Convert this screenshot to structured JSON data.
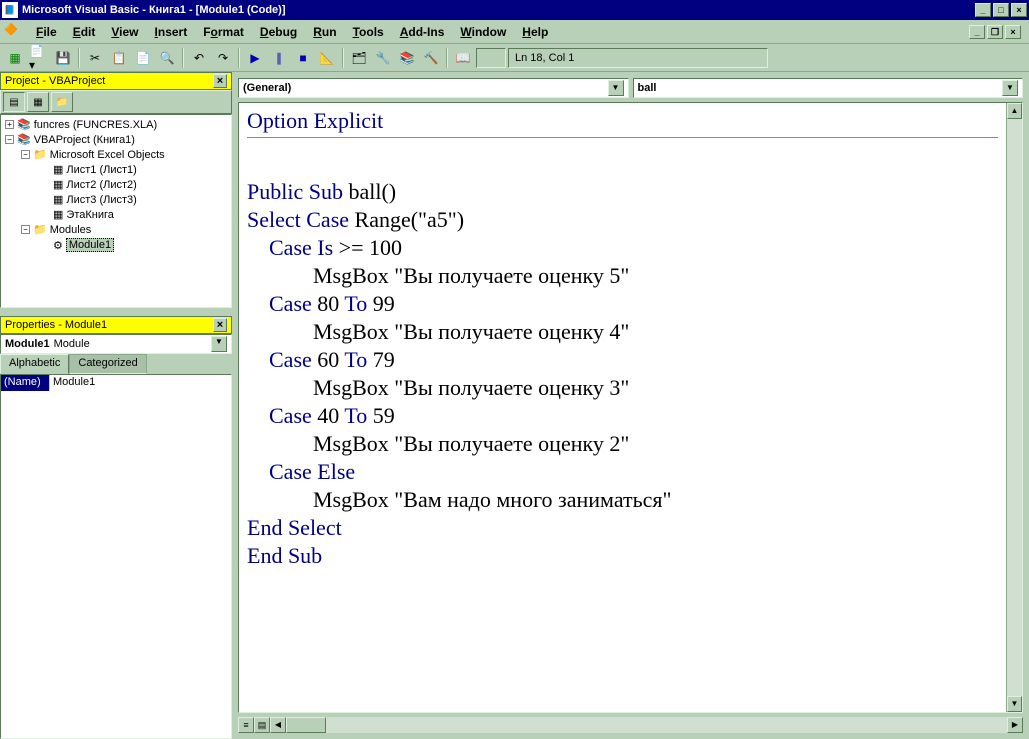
{
  "title": "Microsoft Visual Basic - Книга1 - [Module1 (Code)]",
  "menu": {
    "file": "File",
    "edit": "Edit",
    "view": "View",
    "insert": "Insert",
    "format": "Format",
    "debug": "Debug",
    "run": "Run",
    "tools": "Tools",
    "addins": "Add-Ins",
    "window": "Window",
    "help": "Help"
  },
  "toolbar": {
    "position": "Ln 18, Col 1"
  },
  "project": {
    "title": "Project - VBAProject",
    "items": [
      {
        "level": 1,
        "exp": "+",
        "icon": "📚",
        "label": "funcres (FUNCRES.XLA)"
      },
      {
        "level": 1,
        "exp": "−",
        "icon": "📚",
        "label": "VBAProject (Книга1)"
      },
      {
        "level": 2,
        "exp": "−",
        "icon": "📁",
        "label": "Microsoft Excel Objects"
      },
      {
        "level": 3,
        "exp": "",
        "icon": "▦",
        "label": "Лист1 (Лист1)"
      },
      {
        "level": 3,
        "exp": "",
        "icon": "▦",
        "label": "Лист2 (Лист2)"
      },
      {
        "level": 3,
        "exp": "",
        "icon": "▦",
        "label": "Лист3 (Лист3)"
      },
      {
        "level": 3,
        "exp": "",
        "icon": "▦",
        "label": "ЭтаКнига"
      },
      {
        "level": 2,
        "exp": "−",
        "icon": "📁",
        "label": "Modules"
      },
      {
        "level": 3,
        "exp": "",
        "icon": "⚙",
        "label": "Module1",
        "selected": true
      }
    ]
  },
  "properties": {
    "title": "Properties - Module1",
    "object_name": "Module1",
    "object_type": "Module",
    "tabs": {
      "a": "Alphabetic",
      "c": "Categorized"
    },
    "rows": [
      {
        "name": "(Name)",
        "value": "Module1"
      }
    ]
  },
  "code": {
    "object_combo": "(General)",
    "proc_combo": "ball",
    "lines": [
      {
        "t": "opt",
        "kw": "Option Explicit"
      },
      {
        "t": "div"
      },
      {
        "t": "blank"
      },
      {
        "t": "sub",
        "kw": "Public Sub ",
        "txt": "ball()"
      },
      {
        "t": "sel",
        "kw": "Select Case ",
        "txt": "Range(\"a5\")"
      },
      {
        "t": "ci",
        "indent": 1,
        "kw": "Case Is ",
        "txt": ">= 100"
      },
      {
        "t": "msg",
        "indent": 2,
        "txt": "MsgBox \"Вы получаете оценку 5\""
      },
      {
        "t": "c",
        "indent": 1,
        "kw": "Case ",
        "txt1": "80 ",
        "kw2": "To ",
        "txt2": "99"
      },
      {
        "t": "msg",
        "indent": 2,
        "txt": "MsgBox \"Вы получаете оценку 4\""
      },
      {
        "t": "c",
        "indent": 1,
        "kw": "Case ",
        "txt1": "60 ",
        "kw2": "To ",
        "txt2": "79"
      },
      {
        "t": "msg",
        "indent": 2,
        "txt": "MsgBox \"Вы получаете оценку 3\""
      },
      {
        "t": "c",
        "indent": 1,
        "kw": "Case ",
        "txt1": "40 ",
        "kw2": "To ",
        "txt2": "59"
      },
      {
        "t": "msg",
        "indent": 2,
        "txt": "MsgBox \"Вы получаете оценку 2\""
      },
      {
        "t": "ce",
        "indent": 1,
        "kw": "Case Else"
      },
      {
        "t": "msg",
        "indent": 2,
        "txt": "MsgBox \"Вам надо много заниматься\""
      },
      {
        "t": "end",
        "kw": "End Select"
      },
      {
        "t": "end",
        "kw": "End Sub"
      }
    ]
  }
}
